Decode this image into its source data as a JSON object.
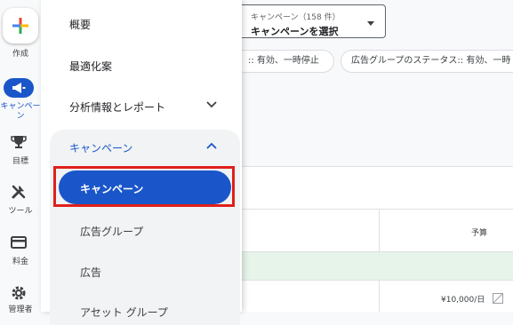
{
  "rail": {
    "create_label": "作成",
    "campaign_label_line1": "キャンペー",
    "campaign_label_line2": "ン",
    "goals_label": "目標",
    "tools_label": "ツール",
    "billing_label": "料金",
    "admin_label": "管理者"
  },
  "drawer": {
    "overview": "概要",
    "recommendations": "最適化案",
    "insights": "分析情報とレポート",
    "section_title": "キャンペーン",
    "sub_items": [
      "キャンペーン",
      "広告グループ",
      "広告",
      "アセット グループ"
    ]
  },
  "main": {
    "selector_label": "キャンペーン（158 件）",
    "selector_value": "キャンペーンを選択",
    "chip1": ":: 有効、一時停止",
    "chip2": "広告グループのステータス:: 有効、一時",
    "budget_header": "予算",
    "budget_value": "¥10,000/日"
  },
  "colors": {
    "accent": "#1a56c9",
    "highlight_box": "#e0201b",
    "row_highlight": "#e6f4ea"
  }
}
